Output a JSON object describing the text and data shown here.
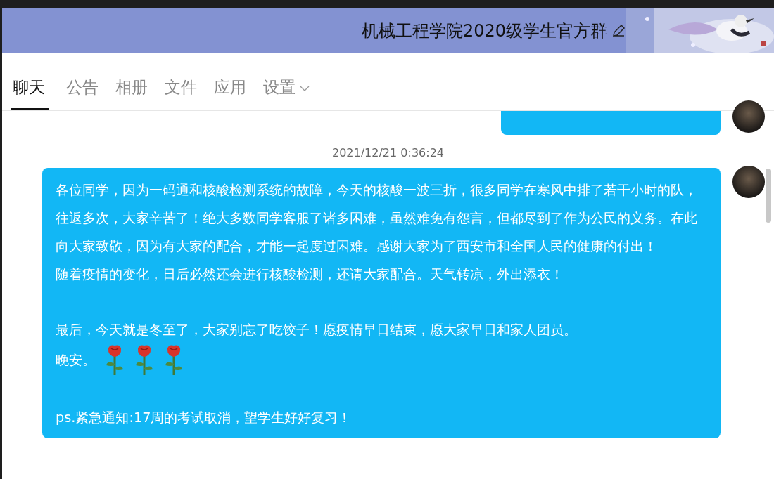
{
  "header": {
    "title": "机械工程学院2020级学生官方群"
  },
  "tabs": [
    {
      "label": "聊天",
      "selected": true
    },
    {
      "label": "公告",
      "selected": false
    },
    {
      "label": "相册",
      "selected": false
    },
    {
      "label": "文件",
      "selected": false
    },
    {
      "label": "应用",
      "selected": false
    },
    {
      "label": "设置",
      "selected": false,
      "dropdown": true
    }
  ],
  "messages": [
    {
      "kind": "partial"
    },
    {
      "kind": "time",
      "text": "2021/12/21 0:36:24"
    },
    {
      "kind": "bubble",
      "groups": [
        {
          "lines": [
            {
              "text": "各位同学，因为一码通和核酸检测系统的故障，今天的核酸一波三折，很多同学在寒风中排了若干小时的队，往返多次，大家辛苦了！绝大多数同学客服了诸多困难，虽然难免有怨言，但都尽到了作为公民的义务。在此向大家致敬，因为有大家的配合，才能一起度过困难。感谢大家为了西安市和全国人民的健康的付出！"
            },
            {
              "text": "随着疫情的变化，日后必然还会进行核酸检测，还请大家配合。天气转凉，外出添衣！"
            }
          ]
        },
        {
          "lines": [
            {
              "text": "最后，今天就是冬至了，大家别忘了吃饺子！愿疫情早日结束，愿大家早日和家人团员。"
            },
            {
              "text": "晚安。",
              "icons": [
                {
                  "kind": "rose"
                },
                {
                  "kind": "rose"
                },
                {
                  "kind": "rose"
                }
              ]
            }
          ]
        },
        {
          "lines": [
            {
              "text": "ps.紧急通知:17周的考试取消，望学生好好复习！"
            }
          ]
        }
      ]
    }
  ]
}
